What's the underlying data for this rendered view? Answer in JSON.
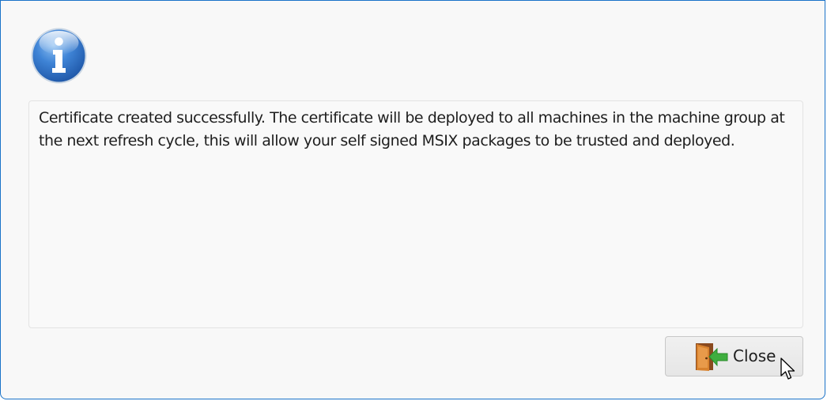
{
  "dialog": {
    "message": "Certificate created successfully. The certificate will be deployed to all machines in the machine group at the next refresh cycle, this will allow your self signed MSIX packages to be trusted and deployed.",
    "icon": "info-icon",
    "close_label": "Close",
    "close_icon": "door-exit-icon"
  },
  "colors": {
    "border": "#1a73c8",
    "background": "#f8f8f8",
    "info_blue": "#2e72c8",
    "door_orange": "#d8822e",
    "arrow_green": "#3fae3f"
  }
}
